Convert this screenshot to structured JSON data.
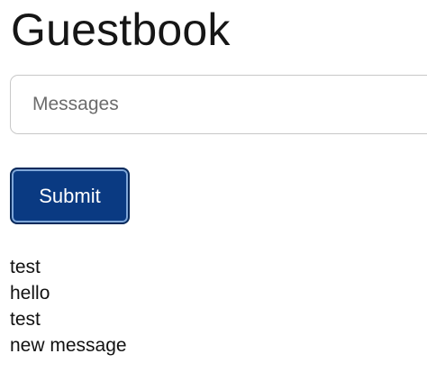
{
  "page": {
    "title": "Guestbook"
  },
  "form": {
    "message_placeholder": "Messages",
    "message_value": "",
    "submit_label": "Submit"
  },
  "messages": [
    "test",
    "hello",
    "test",
    "new message"
  ],
  "colors": {
    "submit_background": "#0a3a82",
    "submit_border": "#082a5c",
    "input_border": "#c8c8c8"
  }
}
